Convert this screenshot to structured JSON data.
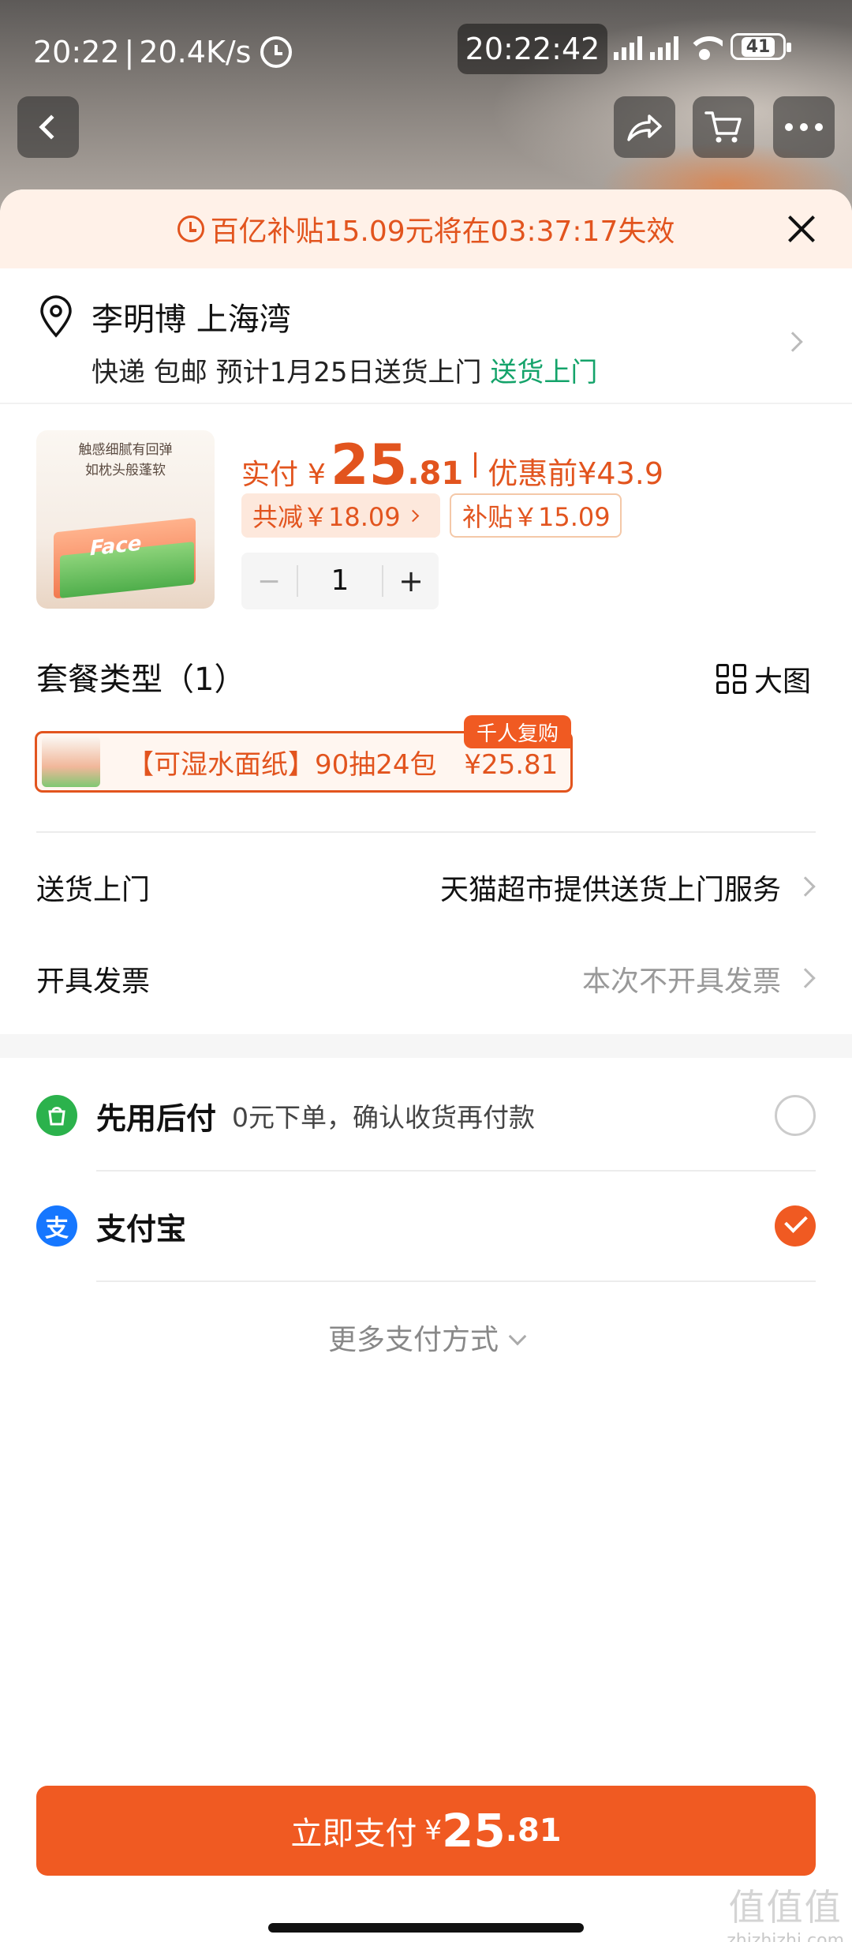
{
  "status_bar": {
    "time_left": "20:22",
    "net_speed": "20.4K/s",
    "clock": "20:22:42",
    "battery": "41"
  },
  "promo_banner": {
    "text": "百亿补贴15.09元将在03:37:17失效"
  },
  "address": {
    "name_line": "李明博 上海湾",
    "delivery_prefix": "快递 包邮 预计1月25日送货上门",
    "delivery_highlight": "送货上门"
  },
  "product": {
    "image_caption_line1": "触感细腻有回弹",
    "image_caption_line2": "如枕头般蓬软",
    "image_brand": "Face",
    "paid_label": "实付",
    "currency": "¥",
    "price_int": "25",
    "price_dec": ".81",
    "before_label": "优惠前",
    "before_price": "¥43.9",
    "reduce_tag": "共减￥18.09",
    "subsidy_tag": "补贴￥15.09",
    "quantity": "1",
    "minus": "−",
    "plus": "+"
  },
  "package": {
    "title": "套餐类型（1）",
    "big_image_label": "大图",
    "option_name": "【可湿水面纸】90抽24包",
    "option_price": "¥25.81",
    "badge": "千人复购"
  },
  "rows": {
    "delivery_label": "送货上门",
    "delivery_value": "天猫超市提供送货上门服务",
    "invoice_label": "开具发票",
    "invoice_value": "本次不开具发票"
  },
  "payment": {
    "option1_name": "先用后付",
    "option1_desc": "0元下单，确认收货再付款",
    "option2_name": "支付宝",
    "option2_icon_glyph": "支",
    "more_label": "更多支付方式",
    "selected": "支付宝"
  },
  "pay_button": {
    "label": "立即支付",
    "currency": "¥",
    "price_int": "25",
    "price_dec": ".81"
  },
  "watermark": {
    "big": "值值值",
    "small": "zhizhizhi.com"
  },
  "colors": {
    "accent": "#f05a22",
    "accent_text": "#e2541e",
    "green": "#14a36a",
    "alipay_blue": "#1677ff",
    "paylater_green": "#2bb24c"
  }
}
